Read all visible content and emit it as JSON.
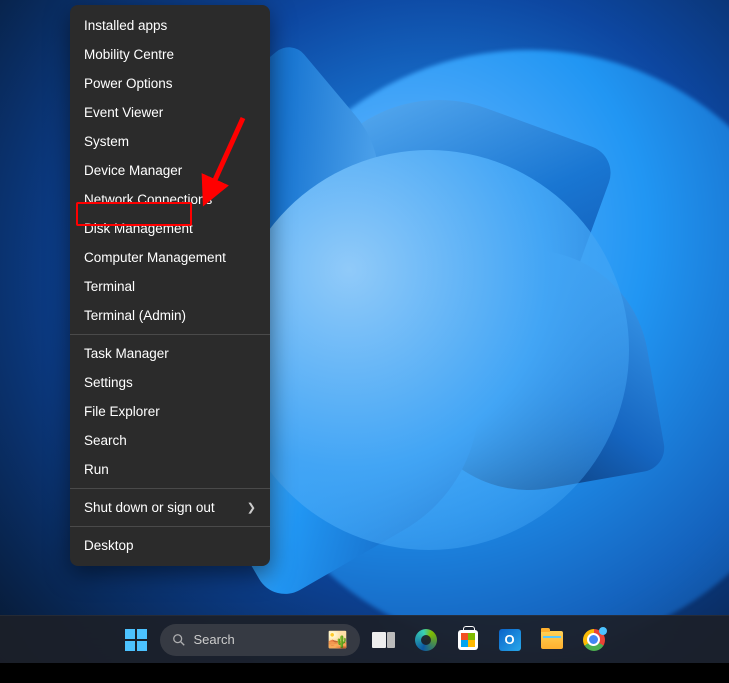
{
  "contextMenu": {
    "groups": [
      [
        "Installed apps",
        "Mobility Centre",
        "Power Options",
        "Event Viewer",
        "System",
        "Device Manager",
        "Network Connections",
        "Disk Management",
        "Computer Management",
        "Terminal",
        "Terminal (Admin)"
      ],
      [
        "Task Manager",
        "Settings",
        "File Explorer",
        "Search",
        "Run"
      ],
      [
        "Shut down or sign out"
      ],
      [
        "Desktop"
      ]
    ],
    "hasSubmenu": [
      "Shut down or sign out"
    ],
    "highlighted": "Device Manager"
  },
  "taskbar": {
    "searchPlaceholder": "Search",
    "icons": [
      "task-view",
      "edge",
      "microsoft-store",
      "outlook",
      "file-explorer",
      "chrome"
    ]
  }
}
